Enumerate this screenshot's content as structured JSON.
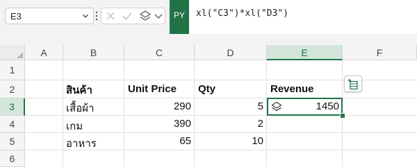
{
  "name_box": {
    "value": "E3"
  },
  "formula_bar": {
    "mode_badge": "PY",
    "formula": "xl(\"C3\")*xl(\"D3\")"
  },
  "columns": [
    "A",
    "B",
    "C",
    "D",
    "E",
    "F"
  ],
  "rows": [
    "1",
    "2",
    "3",
    "4",
    "5",
    "6"
  ],
  "selected_cell": "E3",
  "headers": {
    "product": "สินค้า",
    "unit_price": "Unit Price",
    "qty": "Qty",
    "revenue": "Revenue"
  },
  "data_rows": [
    {
      "product": "เสื้อผ้า",
      "unit_price": "290",
      "qty": "5",
      "revenue": "1450"
    },
    {
      "product": "เกม",
      "unit_price": "390",
      "qty": "2",
      "revenue": ""
    },
    {
      "product": "อาหาร",
      "unit_price": "65",
      "qty": "10",
      "revenue": ""
    }
  ],
  "icons": {
    "name_box_dropdown": "chevron-down-icon",
    "more_options": "vertical-ellipsis-icon",
    "cancel": "x-icon",
    "enter": "check-icon",
    "python_output": "layers-icon",
    "insert_data": "insert-data-icon"
  },
  "colors": {
    "accent": "#217346",
    "selected_header_bg": "#d2e7da"
  }
}
